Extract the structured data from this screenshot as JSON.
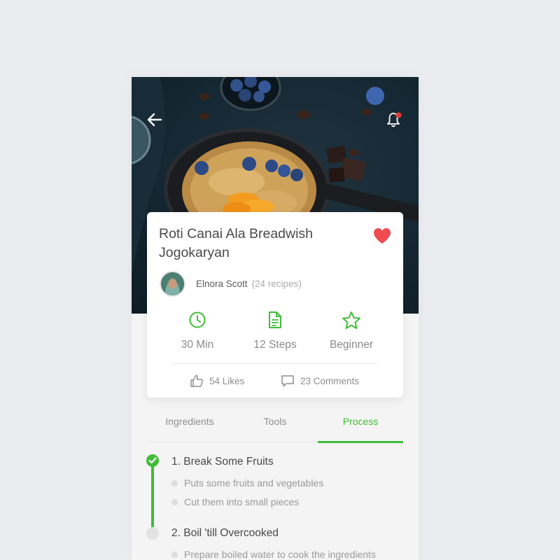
{
  "recipe": {
    "title": "Roti Canai Ala Breadwish Jogokaryan",
    "favorite": true
  },
  "author": {
    "name": "Elnora Scott",
    "recipes_count": "(24 recipes)"
  },
  "stats": [
    {
      "icon": "clock-icon",
      "label": "30 Min"
    },
    {
      "icon": "document-icon",
      "label": "12 Steps"
    },
    {
      "icon": "star-icon",
      "label": "Beginner"
    }
  ],
  "social": {
    "likes": "54 Likes",
    "comments": "23 Comments"
  },
  "tabs": [
    {
      "label": "Ingredients",
      "active": false
    },
    {
      "label": "Tools",
      "active": false
    },
    {
      "label": "Process",
      "active": true
    }
  ],
  "process": [
    {
      "title": "1. Break Some Fruits",
      "done": true,
      "items": [
        "Puts some fruits and vegetables",
        "Cut them into small pieces"
      ]
    },
    {
      "title": "2. Boil 'till Overcooked",
      "done": false,
      "items": [
        "Prepare boiled water to cook the ingredients"
      ]
    }
  ],
  "colors": {
    "accent": "#41bc37",
    "favorite": "#ef4b50",
    "notification": "#e53935",
    "background": "#eaecef"
  }
}
